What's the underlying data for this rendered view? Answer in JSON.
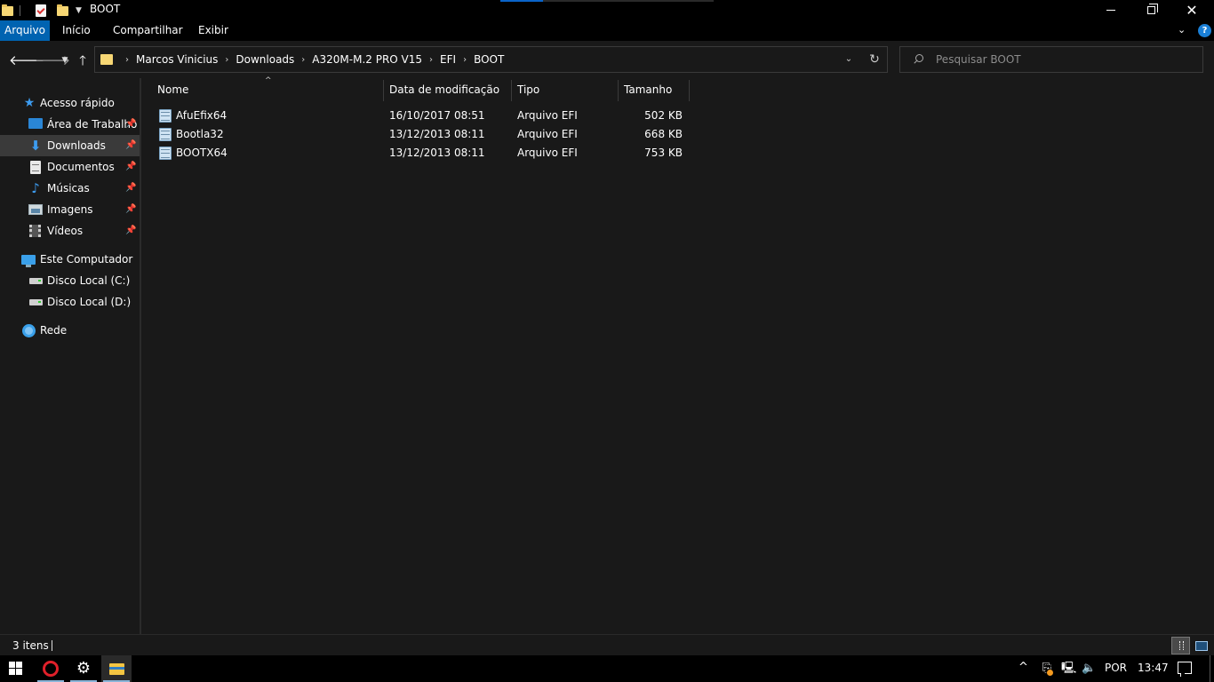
{
  "window": {
    "title": "BOOT"
  },
  "ribbon": {
    "tabs": [
      {
        "label": "Arquivo"
      },
      {
        "label": "Início"
      },
      {
        "label": "Compartilhar"
      },
      {
        "label": "Exibir"
      }
    ]
  },
  "address": {
    "breadcrumbs": [
      "Marcos Vinicius",
      "Downloads",
      "A320M-M.2 PRO V15",
      "EFI",
      "BOOT"
    ]
  },
  "search": {
    "placeholder": "Pesquisar BOOT"
  },
  "navigation": {
    "quick_access": "Acesso rápido",
    "items": [
      {
        "label": "Área de Trabalho",
        "icon": "desktop-icon",
        "pinned": true
      },
      {
        "label": "Downloads",
        "icon": "downloads-icon",
        "pinned": true,
        "selected": true
      },
      {
        "label": "Documentos",
        "icon": "documents-icon",
        "pinned": true
      },
      {
        "label": "Músicas",
        "icon": "music-icon",
        "pinned": true
      },
      {
        "label": "Imagens",
        "icon": "pictures-icon",
        "pinned": true
      },
      {
        "label": "Vídeos",
        "icon": "videos-icon",
        "pinned": true
      }
    ],
    "this_pc": "Este Computador",
    "drives": [
      {
        "label": "Disco Local (C:)"
      },
      {
        "label": "Disco Local (D:)"
      }
    ],
    "network": "Rede"
  },
  "file_list": {
    "columns": [
      "Nome",
      "Data de modificação",
      "Tipo",
      "Tamanho"
    ],
    "rows": [
      {
        "name": "AfuEfix64",
        "date": "16/10/2017 08:51",
        "type": "Arquivo EFI",
        "size": "502 KB"
      },
      {
        "name": "Bootla32",
        "date": "13/12/2013 08:11",
        "type": "Arquivo EFI",
        "size": "668 KB"
      },
      {
        "name": "BOOTX64",
        "date": "13/12/2013 08:11",
        "type": "Arquivo EFI",
        "size": "753 KB"
      }
    ]
  },
  "status": {
    "item_count": "3 itens"
  },
  "taskbar": {
    "language": "POR",
    "time": "13:47"
  },
  "colors": {
    "accent": "#0063b1",
    "background": "#191919",
    "selection": "#3a3a3a"
  }
}
